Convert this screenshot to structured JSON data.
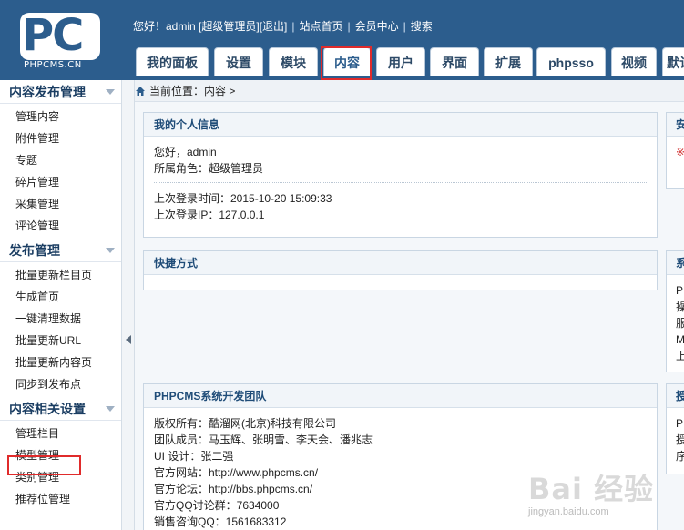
{
  "logo": {
    "brand": "PC",
    "subtitle": "PHPCMS.CN"
  },
  "topbar": {
    "greeting": "您好！admin [超级管理员]",
    "logout": "[退出]",
    "home": "站点首页",
    "member": "会员中心",
    "search": "搜索"
  },
  "nav": {
    "tabs": [
      "我的面板",
      "设置",
      "模块",
      "内容",
      "用户",
      "界面",
      "扩展",
      "phpsso",
      "视频",
      "默认"
    ]
  },
  "sidebar": {
    "sections": [
      {
        "title": "内容发布管理",
        "items": [
          "管理内容",
          "附件管理",
          "专题",
          "碎片管理",
          "采集管理",
          "评论管理"
        ]
      },
      {
        "title": "发布管理",
        "items": [
          "批量更新栏目页",
          "生成首页",
          "一键清理数据",
          "批量更新URL",
          "批量更新内容页",
          "同步到发布点"
        ]
      },
      {
        "title": "内容相关设置",
        "items": [
          "管理栏目",
          "模型管理",
          "类别管理",
          "推荐位管理"
        ]
      }
    ]
  },
  "breadcrumb": "当前位置：内容 >",
  "panels": {
    "personal": {
      "title": "我的个人信息",
      "lines": [
        "您好，admin",
        "所属角色：超级管理员"
      ],
      "login_lines": [
        "上次登录时间：2015-10-20 15:09:33",
        "上次登录IP：127.0.0.1"
      ]
    },
    "shortcut": {
      "title": "快捷方式"
    },
    "team": {
      "title": "PHPCMS系统开发团队",
      "lines": [
        "版权所有：酷溜网(北京)科技有限公司",
        "团队成员：马玉辉、张明雪、李天会、潘兆志",
        "UI 设计：张二强",
        "官方网站：http://www.phpcms.cn/",
        "官方论坛：http://bbs.phpcms.cn/",
        "官方QQ讨论群：7634000",
        "销售咨询QQ：1561683312"
      ]
    }
  },
  "right_panels": {
    "top": {
      "title": "安",
      "mark": "※"
    },
    "middle": {
      "title": "系",
      "lines": [
        "P",
        "操",
        "服",
        "M",
        "上"
      ]
    },
    "bottom": {
      "title": "授",
      "lines": [
        "P",
        "授",
        "序"
      ]
    }
  },
  "watermark": {
    "main": "Bai 经验",
    "sub": "jingyan.baidu.com"
  }
}
